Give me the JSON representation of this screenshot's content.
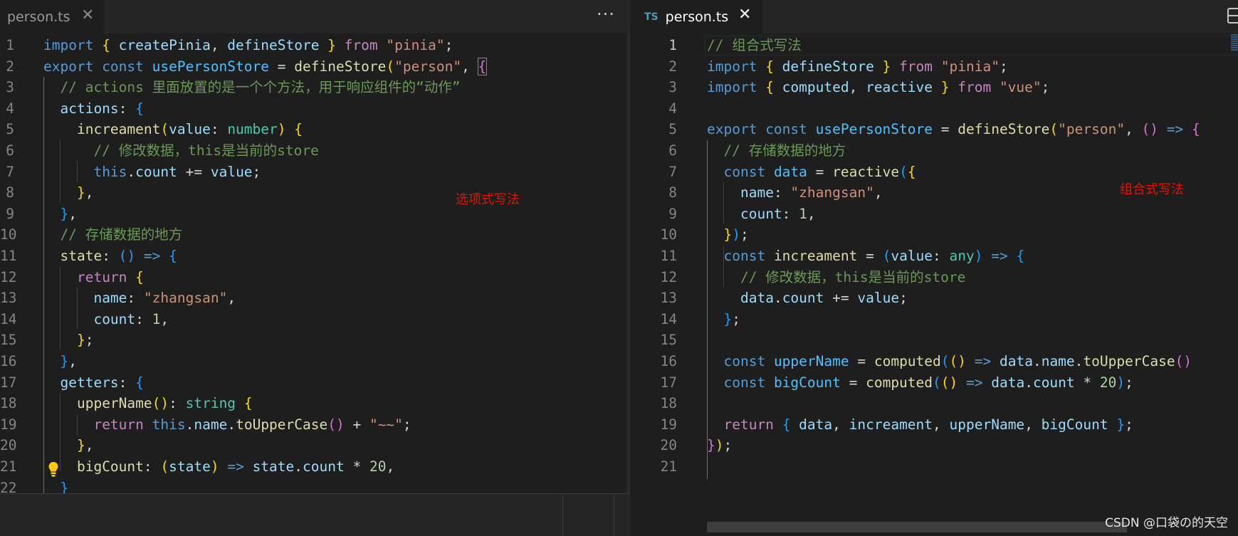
{
  "left_editor": {
    "tab": {
      "filename": "person.ts",
      "close_glyph": "✕"
    },
    "more_actions_glyph": "···",
    "annotation": "选项式写法",
    "lines": [
      {
        "n": "1",
        "t": [
          [
            "kw",
            "import "
          ],
          [
            "b1",
            "{ "
          ],
          [
            "vr",
            "createPinia"
          ],
          [
            "pn",
            ", "
          ],
          [
            "vr",
            "defineStore"
          ],
          [
            "b1",
            " }"
          ],
          [
            "ctl",
            " from "
          ],
          [
            "str",
            "\"pinia\""
          ],
          [
            "pn",
            ";"
          ]
        ]
      },
      {
        "n": "2",
        "t": [
          [
            "kw",
            "export "
          ],
          [
            "kw",
            "const "
          ],
          [
            "cst",
            "usePersonStore"
          ],
          [
            "pn",
            " = "
          ],
          [
            "fn",
            "defineStore"
          ],
          [
            "b1",
            "("
          ],
          [
            "str",
            "\"person\""
          ],
          [
            "pn",
            ", "
          ],
          [
            "b2",
            "{"
          ]
        ]
      },
      {
        "n": "3",
        "t": [
          [
            "cm",
            "  // actions 里面放置的是一个个方法，用于响应组件的“动作”"
          ]
        ]
      },
      {
        "n": "4",
        "t": [
          [
            "pn",
            "  "
          ],
          [
            "vr",
            "actions"
          ],
          [
            "pn",
            ": "
          ],
          [
            "b3",
            "{"
          ]
        ]
      },
      {
        "n": "5",
        "t": [
          [
            "pn",
            "    "
          ],
          [
            "fn",
            "increament"
          ],
          [
            "b1",
            "("
          ],
          [
            "vr",
            "value"
          ],
          [
            "pn",
            ": "
          ],
          [
            "ty",
            "number"
          ],
          [
            "b1",
            ")"
          ],
          [
            "pn",
            " "
          ],
          [
            "b1",
            "{"
          ]
        ]
      },
      {
        "n": "6",
        "t": [
          [
            "cm",
            "      // 修改数据，this是当前的store"
          ]
        ]
      },
      {
        "n": "7",
        "t": [
          [
            "pn",
            "      "
          ],
          [
            "kw",
            "this"
          ],
          [
            "pn",
            "."
          ],
          [
            "vr",
            "count"
          ],
          [
            "pn",
            " += "
          ],
          [
            "vr",
            "value"
          ],
          [
            "pn",
            ";"
          ]
        ]
      },
      {
        "n": "8",
        "t": [
          [
            "pn",
            "    "
          ],
          [
            "b1",
            "}"
          ],
          [
            "pn",
            ","
          ]
        ]
      },
      {
        "n": "9",
        "t": [
          [
            "pn",
            "  "
          ],
          [
            "b3",
            "}"
          ],
          [
            "pn",
            ","
          ]
        ]
      },
      {
        "n": "10",
        "t": [
          [
            "cm",
            "  // 存储数据的地方"
          ]
        ]
      },
      {
        "n": "11",
        "t": [
          [
            "pn",
            "  "
          ],
          [
            "fn",
            "state"
          ],
          [
            "pn",
            ": "
          ],
          [
            "b3",
            "()"
          ],
          [
            "pn",
            " "
          ],
          [
            "kw",
            "=>"
          ],
          [
            "pn",
            " "
          ],
          [
            "b3",
            "{"
          ]
        ]
      },
      {
        "n": "12",
        "t": [
          [
            "pn",
            "    "
          ],
          [
            "ctl",
            "return"
          ],
          [
            "pn",
            " "
          ],
          [
            "b1",
            "{"
          ]
        ]
      },
      {
        "n": "13",
        "t": [
          [
            "pn",
            "      "
          ],
          [
            "vr",
            "name"
          ],
          [
            "pn",
            ": "
          ],
          [
            "str",
            "\"zhangsan\""
          ],
          [
            "pn",
            ","
          ]
        ]
      },
      {
        "n": "14",
        "t": [
          [
            "pn",
            "      "
          ],
          [
            "vr",
            "count"
          ],
          [
            "pn",
            ": "
          ],
          [
            "num",
            "1"
          ],
          [
            "pn",
            ","
          ]
        ]
      },
      {
        "n": "15",
        "t": [
          [
            "pn",
            "    "
          ],
          [
            "b1",
            "}"
          ],
          [
            "pn",
            ";"
          ]
        ]
      },
      {
        "n": "16",
        "t": [
          [
            "pn",
            "  "
          ],
          [
            "b3",
            "}"
          ],
          [
            "pn",
            ","
          ]
        ]
      },
      {
        "n": "17",
        "t": [
          [
            "pn",
            "  "
          ],
          [
            "vr",
            "getters"
          ],
          [
            "pn",
            ": "
          ],
          [
            "b3",
            "{"
          ]
        ]
      },
      {
        "n": "18",
        "t": [
          [
            "pn",
            "    "
          ],
          [
            "fn",
            "upperName"
          ],
          [
            "b1",
            "()"
          ],
          [
            "pn",
            ": "
          ],
          [
            "ty",
            "string"
          ],
          [
            "pn",
            " "
          ],
          [
            "b1",
            "{"
          ]
        ]
      },
      {
        "n": "19",
        "t": [
          [
            "pn",
            "      "
          ],
          [
            "ctl",
            "return"
          ],
          [
            "pn",
            " "
          ],
          [
            "kw",
            "this"
          ],
          [
            "pn",
            "."
          ],
          [
            "vr",
            "name"
          ],
          [
            "pn",
            "."
          ],
          [
            "fn",
            "toUpperCase"
          ],
          [
            "b2",
            "()"
          ],
          [
            "pn",
            " + "
          ],
          [
            "str",
            "\"~~\""
          ],
          [
            "pn",
            ";"
          ]
        ]
      },
      {
        "n": "20",
        "t": [
          [
            "pn",
            "    "
          ],
          [
            "b1",
            "}"
          ],
          [
            "pn",
            ","
          ]
        ]
      },
      {
        "n": "21",
        "t": [
          [
            "pn",
            "    "
          ],
          [
            "fn",
            "bigCount"
          ],
          [
            "pn",
            ": "
          ],
          [
            "b1",
            "("
          ],
          [
            "vr",
            "state"
          ],
          [
            "b1",
            ")"
          ],
          [
            "pn",
            " "
          ],
          [
            "kw",
            "=>"
          ],
          [
            "pn",
            " "
          ],
          [
            "vr",
            "state"
          ],
          [
            "pn",
            "."
          ],
          [
            "vr",
            "count"
          ],
          [
            "pn",
            " * "
          ],
          [
            "num",
            "20"
          ],
          [
            "pn",
            ","
          ]
        ]
      },
      {
        "n": "22",
        "t": [
          [
            "pn",
            "  "
          ],
          [
            "b3",
            "}"
          ]
        ]
      }
    ]
  },
  "right_editor": {
    "tab": {
      "badge": "TS",
      "filename": "person.ts",
      "close_glyph": "✕"
    },
    "annotation": "组合式写法",
    "lines": [
      {
        "n": "1",
        "t": [
          [
            "cm",
            "// 组合式写法"
          ]
        ]
      },
      {
        "n": "2",
        "t": [
          [
            "kw",
            "import "
          ],
          [
            "b1",
            "{ "
          ],
          [
            "vr",
            "defineStore"
          ],
          [
            "b1",
            " }"
          ],
          [
            "ctl",
            " from "
          ],
          [
            "str",
            "\"pinia\""
          ],
          [
            "pn",
            ";"
          ]
        ]
      },
      {
        "n": "3",
        "t": [
          [
            "kw",
            "import "
          ],
          [
            "b1",
            "{ "
          ],
          [
            "vr",
            "computed"
          ],
          [
            "pn",
            ", "
          ],
          [
            "vr",
            "reactive"
          ],
          [
            "b1",
            " }"
          ],
          [
            "ctl",
            " from "
          ],
          [
            "str",
            "\"vue\""
          ],
          [
            "pn",
            ";"
          ]
        ]
      },
      {
        "n": "4",
        "t": []
      },
      {
        "n": "5",
        "t": [
          [
            "kw",
            "export "
          ],
          [
            "kw",
            "const "
          ],
          [
            "cst",
            "usePersonStore"
          ],
          [
            "pn",
            " = "
          ],
          [
            "fn",
            "defineStore"
          ],
          [
            "b1",
            "("
          ],
          [
            "str",
            "\"person\""
          ],
          [
            "pn",
            ", "
          ],
          [
            "b2",
            "()"
          ],
          [
            "pn",
            " "
          ],
          [
            "kw",
            "=>"
          ],
          [
            "pn",
            " "
          ],
          [
            "b2",
            "{"
          ]
        ]
      },
      {
        "n": "6",
        "t": [
          [
            "cm",
            "  // 存储数据的地方"
          ]
        ]
      },
      {
        "n": "7",
        "t": [
          [
            "pn",
            "  "
          ],
          [
            "kw",
            "const "
          ],
          [
            "cst",
            "data"
          ],
          [
            "pn",
            " = "
          ],
          [
            "fn",
            "reactive"
          ],
          [
            "b3",
            "("
          ],
          [
            "b1",
            "{"
          ]
        ]
      },
      {
        "n": "8",
        "t": [
          [
            "pn",
            "    "
          ],
          [
            "vr",
            "name"
          ],
          [
            "pn",
            ": "
          ],
          [
            "str",
            "\"zhangsan\""
          ],
          [
            "pn",
            ","
          ]
        ]
      },
      {
        "n": "9",
        "t": [
          [
            "pn",
            "    "
          ],
          [
            "vr",
            "count"
          ],
          [
            "pn",
            ": "
          ],
          [
            "num",
            "1"
          ],
          [
            "pn",
            ","
          ]
        ]
      },
      {
        "n": "10",
        "t": [
          [
            "pn",
            "  "
          ],
          [
            "b1",
            "}"
          ],
          [
            "b3",
            ")"
          ],
          [
            "pn",
            ";"
          ]
        ]
      },
      {
        "n": "11",
        "t": [
          [
            "pn",
            "  "
          ],
          [
            "kw",
            "const "
          ],
          [
            "fn",
            "increament"
          ],
          [
            "pn",
            " = "
          ],
          [
            "b3",
            "("
          ],
          [
            "vr",
            "value"
          ],
          [
            "pn",
            ": "
          ],
          [
            "ty",
            "any"
          ],
          [
            "b3",
            ")"
          ],
          [
            "pn",
            " "
          ],
          [
            "kw",
            "=>"
          ],
          [
            "pn",
            " "
          ],
          [
            "b3",
            "{"
          ]
        ]
      },
      {
        "n": "12",
        "t": [
          [
            "cm",
            "    // 修改数据，this是当前的store"
          ]
        ]
      },
      {
        "n": "13",
        "t": [
          [
            "pn",
            "    "
          ],
          [
            "vr",
            "data"
          ],
          [
            "pn",
            "."
          ],
          [
            "vr",
            "count"
          ],
          [
            "pn",
            " += "
          ],
          [
            "vr",
            "value"
          ],
          [
            "pn",
            ";"
          ]
        ]
      },
      {
        "n": "14",
        "t": [
          [
            "pn",
            "  "
          ],
          [
            "b3",
            "}"
          ],
          [
            "pn",
            ";"
          ]
        ]
      },
      {
        "n": "15",
        "t": []
      },
      {
        "n": "16",
        "t": [
          [
            "pn",
            "  "
          ],
          [
            "kw",
            "const "
          ],
          [
            "cst",
            "upperName"
          ],
          [
            "pn",
            " = "
          ],
          [
            "fn",
            "computed"
          ],
          [
            "b3",
            "("
          ],
          [
            "b1",
            "()"
          ],
          [
            "pn",
            " "
          ],
          [
            "kw",
            "=>"
          ],
          [
            "pn",
            " "
          ],
          [
            "vr",
            "data"
          ],
          [
            "pn",
            "."
          ],
          [
            "vr",
            "name"
          ],
          [
            "pn",
            "."
          ],
          [
            "fn",
            "toUpperCase"
          ],
          [
            "b2",
            "()"
          ]
        ]
      },
      {
        "n": "17",
        "t": [
          [
            "pn",
            "  "
          ],
          [
            "kw",
            "const "
          ],
          [
            "cst",
            "bigCount"
          ],
          [
            "pn",
            " = "
          ],
          [
            "fn",
            "computed"
          ],
          [
            "b3",
            "("
          ],
          [
            "b1",
            "()"
          ],
          [
            "pn",
            " "
          ],
          [
            "kw",
            "=>"
          ],
          [
            "pn",
            " "
          ],
          [
            "vr",
            "data"
          ],
          [
            "pn",
            "."
          ],
          [
            "vr",
            "count"
          ],
          [
            "pn",
            " * "
          ],
          [
            "num",
            "20"
          ],
          [
            "b3",
            ")"
          ],
          [
            "pn",
            ";"
          ]
        ]
      },
      {
        "n": "18",
        "t": []
      },
      {
        "n": "19",
        "t": [
          [
            "pn",
            "  "
          ],
          [
            "ctl",
            "return"
          ],
          [
            "pn",
            " "
          ],
          [
            "b3",
            "{ "
          ],
          [
            "vr",
            "data"
          ],
          [
            "pn",
            ", "
          ],
          [
            "vr",
            "increament"
          ],
          [
            "pn",
            ", "
          ],
          [
            "vr",
            "upperName"
          ],
          [
            "pn",
            ", "
          ],
          [
            "vr",
            "bigCount"
          ],
          [
            "b3",
            " }"
          ],
          [
            "pn",
            ";"
          ]
        ]
      },
      {
        "n": "20",
        "t": [
          [
            "b2",
            "}"
          ],
          [
            "b1",
            ")"
          ],
          [
            "pn",
            ";"
          ]
        ]
      },
      {
        "n": "21",
        "t": []
      }
    ]
  },
  "watermark": "CSDN @口袋の的天空",
  "colors": {
    "background": "#1e1e1e",
    "tabbar": "#252526",
    "annotation_red": "#e51400"
  },
  "icons": {
    "close": "close-icon",
    "more": "more-actions-icon",
    "lightbulb": "lightbulb-icon",
    "layout": "split-editor-icon"
  }
}
